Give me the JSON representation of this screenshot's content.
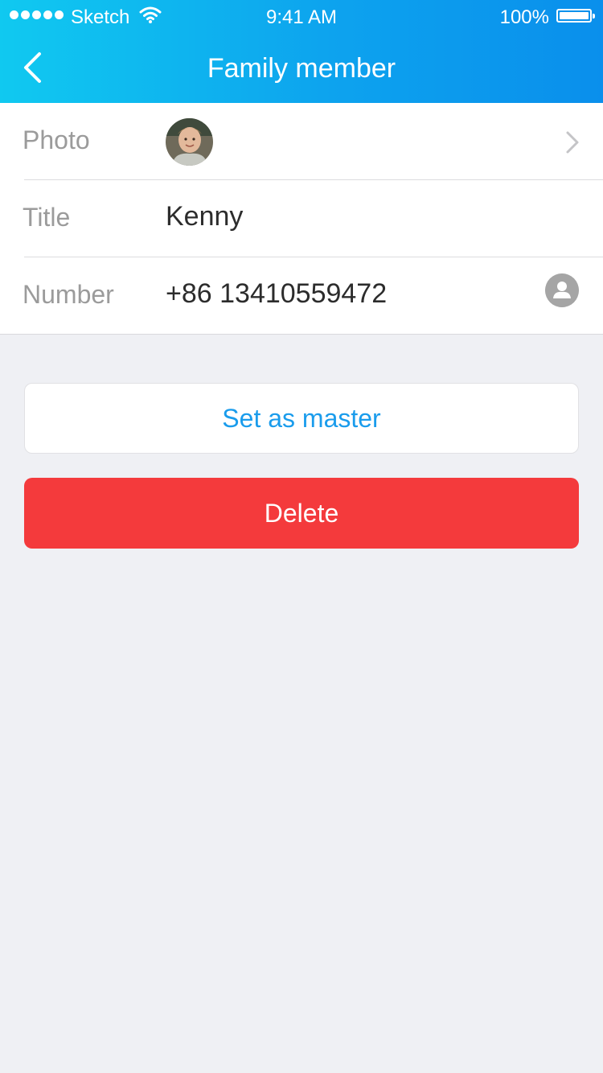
{
  "status_bar": {
    "carrier": "Sketch",
    "time": "9:41 AM",
    "battery": "100%"
  },
  "nav": {
    "title": "Family member",
    "back_icon": "chevron-left-icon"
  },
  "form": {
    "photo_label": "Photo",
    "title_label": "Title",
    "title_value": "Kenny",
    "number_label": "Number",
    "number_value": "+86 13410559472"
  },
  "actions": {
    "set_master_label": "Set as master",
    "delete_label": "Delete"
  },
  "colors": {
    "header_start": "#10c9f0",
    "header_end": "#0a8fec",
    "accent": "#1a9cec",
    "danger": "#f43a3c",
    "background": "#eff0f4"
  }
}
